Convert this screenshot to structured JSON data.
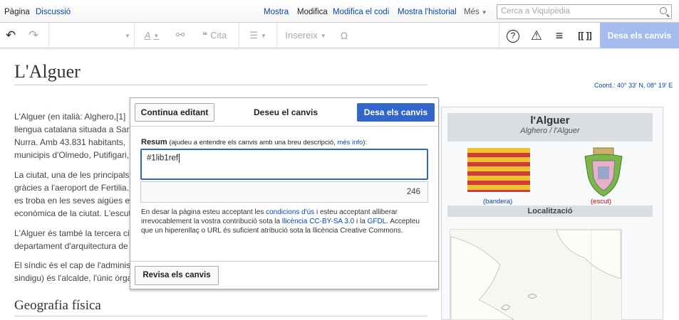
{
  "tabs": {
    "page": "Pàgina",
    "discussion": "Discussió",
    "show": "Mostra",
    "edit": "Modifica",
    "edit_source": "Modifica el codi",
    "history": "Mostra l'historial",
    "more": "Més"
  },
  "search": {
    "placeholder": "Cerca a Viquipèdia"
  },
  "toolbar": {
    "undo": "↶",
    "redo": "↷",
    "style": "A",
    "link": "⚯",
    "cite": "Cita",
    "list": "☰",
    "insert": "Insereix",
    "special": "Ω",
    "help": "?",
    "warning": "⚠",
    "menu": "≡",
    "wikitext": "[[ ]]",
    "save": "Desa els canvis"
  },
  "article": {
    "title": "L'Alguer",
    "coords": "Coord.: 40° 33′ N, 08° 19′ E",
    "p1": [
      "L'Alguer (en italià: Alghero,[1]",
      "llengua catalana situada a Sar",
      "Nurra. Amb 43.831 habitants, ",
      "municipis d'Olmedo, Putifigari, "
    ],
    "p2": [
      "La ciutat, una de les principals",
      "gràcies a l'aeroport de Fertilia.",
      "es troba en les seves aigües e",
      "econòmica de la ciutat. L'escut"
    ],
    "p3": [
      "L'Alguer és també la tercera ci",
      "departament d'arquitectura de"
    ],
    "p4": [
      "El síndic és el cap de l'adminis",
      "sindigu) és l'alcalde, l'únic òrga"
    ],
    "section": "Geografia física"
  },
  "infobox": {
    "name": "l'Alguer",
    "subtitle": "Alghero / l'Alguer",
    "flag_caption": "(bandera)",
    "shield_caption": "(escut)",
    "location": "Localització"
  },
  "dialog": {
    "continue": "Continua editant",
    "title": "Deseu el canvis",
    "save": "Desa els canvis",
    "summary_label": "Resum",
    "summary_hint": " (ajudeu a entendre els canvis amb una breu descripció, ",
    "more_info": "més info",
    "summary_hint_end": "):",
    "summary_value": "#1lib1ref",
    "char_count": "246",
    "license_1": "En desar la pàgina esteu acceptant les ",
    "terms_link": "condicions d'ús",
    "license_2": " i esteu acceptant alliberar irrevocablement la vostra contribució sota la ",
    "ccbysa_link": "llicència CC-BY-SA 3.0",
    "license_3": " i la ",
    "gfdl_link": "GFDL",
    "license_4": ". Accepteu que un hiperenllaç o URL és suficient atribució sota la llicència Creative Commons.",
    "review": "Revisa els canvis"
  },
  "colors": {
    "accent": "#3366cc",
    "link": "#0645ad",
    "save_disabled": "#a6bcee"
  }
}
